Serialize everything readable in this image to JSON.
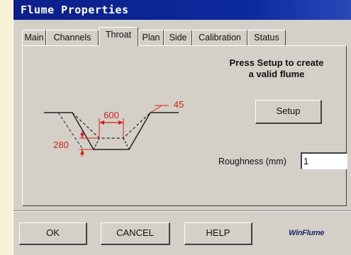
{
  "window": {
    "title": "Flume Properties"
  },
  "tabs": [
    {
      "label": "Main"
    },
    {
      "label": "Channels"
    },
    {
      "label": "Throat"
    },
    {
      "label": "Plan"
    },
    {
      "label": "Side"
    },
    {
      "label": "Calibration"
    },
    {
      "label": "Status"
    }
  ],
  "active_tab": "Throat",
  "panel": {
    "message_line1": "Press Setup to create",
    "message_line2": "a valid flume",
    "setup_label": "Setup",
    "roughness_label": "Roughness (mm)",
    "roughness_value": "1"
  },
  "diagram": {
    "bottom_width": "600",
    "depth": "280",
    "slope": "45"
  },
  "footer": {
    "ok_label": "OK",
    "cancel_label": "CANCEL",
    "help_label": "HELP",
    "logo_text": "WinFlume"
  },
  "colors": {
    "titlebar": "#0c2a9e",
    "dimension": "#d42020",
    "face": "#d4d0c8"
  }
}
